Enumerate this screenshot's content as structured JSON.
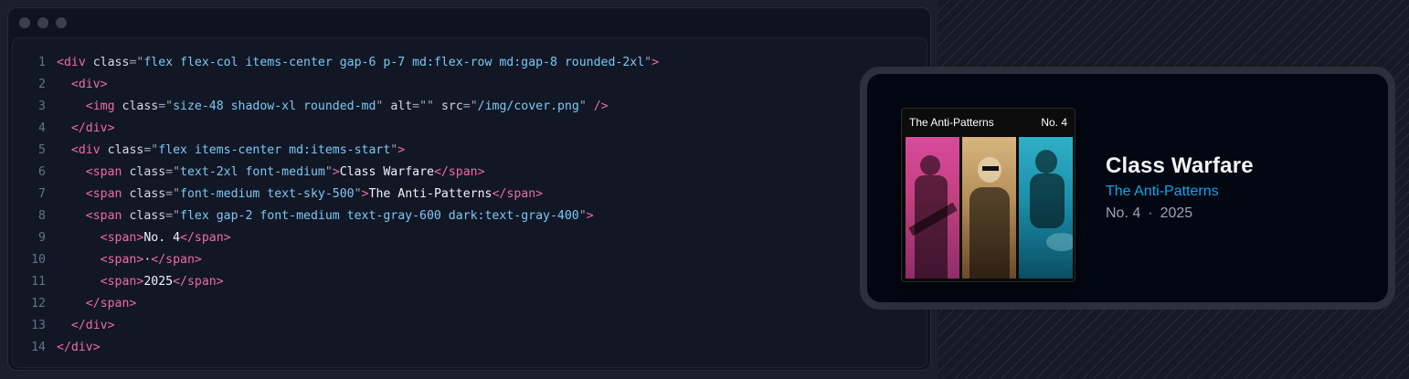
{
  "window": {
    "controls": [
      "close",
      "minimize",
      "maximize"
    ]
  },
  "code": {
    "lines": [
      {
        "n": "1",
        "indent": "",
        "tag": "div",
        "attrs": [
          {
            "name": "class",
            "value": "flex flex-col items-center gap-6 p-7 md:flex-row md:gap-8 rounded-2xl"
          }
        ]
      },
      {
        "n": "2",
        "indent": "  ",
        "tag": "div"
      },
      {
        "n": "3",
        "indent": "    ",
        "tag": "img",
        "attrs": [
          {
            "name": "class",
            "value": "size-48 shadow-xl rounded-md"
          },
          {
            "name": "alt",
            "value": ""
          },
          {
            "name": "src",
            "value": "/img/cover.png"
          }
        ],
        "self_close": true
      },
      {
        "n": "4",
        "indent": "  ",
        "close": "div"
      },
      {
        "n": "5",
        "indent": "  ",
        "tag": "div",
        "attrs": [
          {
            "name": "class",
            "value": "flex items-center md:items-start"
          }
        ]
      },
      {
        "n": "6",
        "indent": "    ",
        "tag": "span",
        "attrs": [
          {
            "name": "class",
            "value": "text-2xl font-medium"
          }
        ],
        "text": "Class Warfare",
        "close": "span"
      },
      {
        "n": "7",
        "indent": "    ",
        "tag": "span",
        "attrs": [
          {
            "name": "class",
            "value": "font-medium text-sky-500"
          }
        ],
        "text": "The Anti-Patterns",
        "close": "span"
      },
      {
        "n": "8",
        "indent": "    ",
        "tag": "span",
        "attrs": [
          {
            "name": "class",
            "value": "flex gap-2 font-medium text-gray-600 dark:text-gray-400"
          }
        ]
      },
      {
        "n": "9",
        "indent": "      ",
        "tag": "span",
        "text": "No. 4",
        "close": "span"
      },
      {
        "n": "10",
        "indent": "      ",
        "tag": "span",
        "text": "·",
        "close": "span"
      },
      {
        "n": "11",
        "indent": "      ",
        "tag": "span",
        "text": "2025",
        "close": "span"
      },
      {
        "n": "12",
        "indent": "    ",
        "close": "span"
      },
      {
        "n": "13",
        "indent": "  ",
        "close": "div"
      },
      {
        "n": "14",
        "indent": "",
        "close": "div"
      }
    ]
  },
  "preview": {
    "cover": {
      "band_name": "The Anti-Patterns",
      "issue": "No. 4",
      "panel_tints": [
        "#d94a9c",
        "#c99f67",
        "#23a0bb"
      ]
    },
    "title": "Class Warfare",
    "artist": "The Anti-Patterns",
    "number": "No. 4",
    "separator": "·",
    "year": "2025",
    "colors": {
      "artist": "#0ea5e9",
      "meta": "#9ca3af",
      "title": "#f3f4f6"
    }
  }
}
